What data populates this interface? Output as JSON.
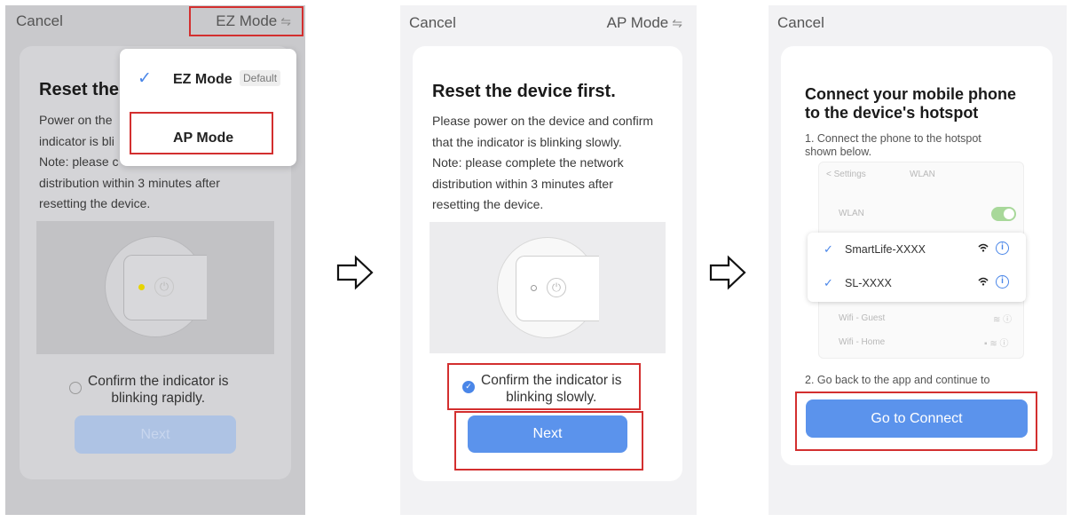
{
  "screen_ez": {
    "cancel": "Cancel",
    "mode_label": "EZ Mode",
    "switch_icon": "⇋",
    "title": "Reset the",
    "body": [
      "Power on the",
      "indicator is bli",
      "Note: please c",
      "distribution within 3 minutes after",
      "resetting the device."
    ],
    "confirm": [
      "Confirm the indicator is",
      "blinking rapidly."
    ],
    "next": "Next",
    "led_color": "#e6d400",
    "dropdown": {
      "ez_label": "EZ Mode",
      "default_badge": "Default",
      "ap_label": "AP Mode"
    }
  },
  "screen_ap": {
    "cancel": "Cancel",
    "mode_label": "AP Mode",
    "switch_icon": "⇋",
    "title": "Reset the device first.",
    "body": [
      "Please power on the device and confirm",
      "that the indicator is blinking slowly.",
      "Note: please complete the network",
      "distribution within 3 minutes after",
      "resetting the device."
    ],
    "confirm": [
      "Confirm the indicator is",
      "blinking slowly."
    ],
    "next": "Next",
    "led_color": "#ffffff"
  },
  "screen_hotspot": {
    "cancel": "Cancel",
    "title": [
      "Connect your mobile phone",
      "to the device's hotspot"
    ],
    "step1": [
      "1. Connect the phone to the hotspot",
      "shown below."
    ],
    "settings_back": "< Settings",
    "settings_title": "WLAN",
    "wlan_label": "WLAN",
    "networks": [
      "SmartLife-XXXX",
      "SL-XXXX"
    ],
    "other_networks": [
      "Wifi - Guest",
      "Wifi - Home"
    ],
    "step2": "2. Go back to the app and continue to",
    "connect": "Go to Connect"
  },
  "colors": {
    "accent": "#5b93ec",
    "highlight": "#d32f2f"
  }
}
